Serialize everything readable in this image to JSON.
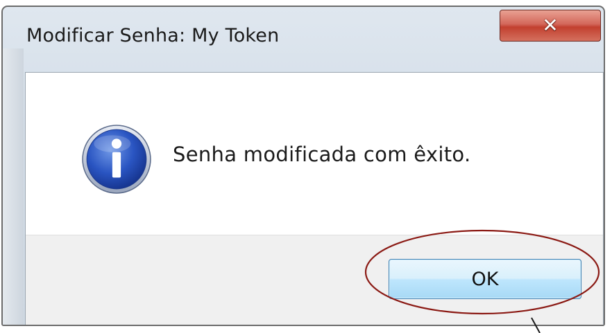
{
  "window": {
    "title": "Modificar Senha: My Token",
    "close_glyph": "✕",
    "close_icon": "close-icon"
  },
  "message": {
    "icon": "info-icon",
    "text": "Senha modificada com êxito."
  },
  "buttons": {
    "ok_label": "OK"
  },
  "colors": {
    "annotation": "#8b1a14",
    "ok_border": "#3c7fb1",
    "close_red": "#c2402f"
  }
}
